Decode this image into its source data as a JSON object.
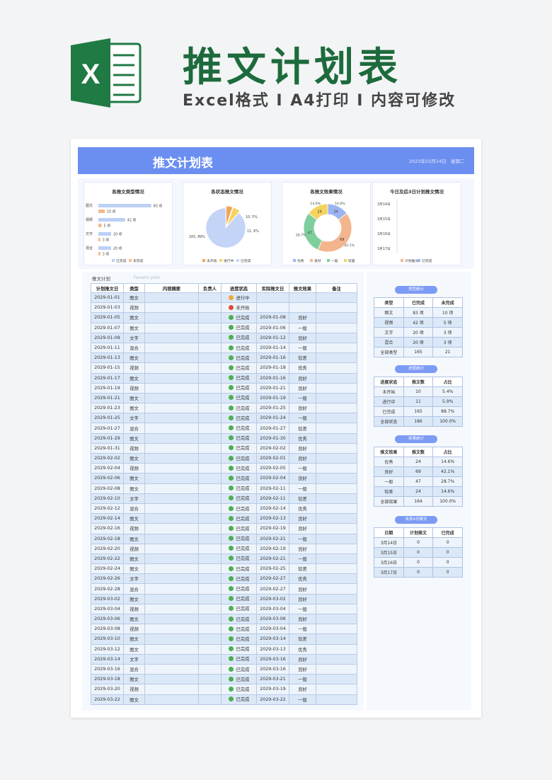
{
  "promo": {
    "logo_letter": "X",
    "title": "推文计划表",
    "subtitle": "Excel格式 I A4打印 I 内容可修改"
  },
  "sheet": {
    "title": "推文计划表",
    "date": "2023年03月14日",
    "weekday": "星期二"
  },
  "charts": {
    "c1": {
      "title": "各推文类型情况",
      "legend": [
        "已完成",
        "未完成"
      ]
    },
    "c2": {
      "title": "各状态推文情况",
      "legend": [
        "未开始",
        "进行中",
        "已完成"
      ]
    },
    "c3": {
      "title": "各推文效果情况",
      "legend": [
        "优秀",
        "良好",
        "一般",
        "较差"
      ]
    },
    "c4": {
      "title": "今日及后3日计划推文情况",
      "legend": [
        "计划推文",
        "已完成"
      ]
    }
  },
  "chart_data": [
    {
      "type": "bar",
      "title": "各推文类型情况",
      "categories": [
        "图文",
        "视频",
        "文字",
        "混合"
      ],
      "series": [
        {
          "name": "已完成",
          "values": [
            83,
            42,
            20,
            20
          ],
          "labels": [
            "83 项",
            "42 项",
            "20 项",
            "20 项"
          ]
        },
        {
          "name": "未完成",
          "values": [
            10,
            5,
            3,
            3
          ],
          "labels": [
            "10 项",
            "5 项",
            "3 项",
            "3 项"
          ]
        }
      ],
      "colors": [
        "#bcd0f6",
        "#f5b98b"
      ],
      "legend": "bottom"
    },
    {
      "type": "pie",
      "title": "各状态推文情况",
      "categories": [
        "未开始",
        "进行中",
        "已完成"
      ],
      "values": [
        10,
        11,
        165
      ],
      "labels": [
        "10, 5%",
        "11, 6%",
        "165, 89%"
      ],
      "colors": [
        "#f0a65a",
        "#f4d35e",
        "#c4d4f7"
      ],
      "legend": "bottom"
    },
    {
      "type": "pie",
      "title": "各推文效果情况",
      "categories": [
        "优秀",
        "良好",
        "一般",
        "较差"
      ],
      "values": [
        24,
        69,
        47,
        24
      ],
      "labels": [
        "14.6%",
        "42.1%",
        "28.7%",
        "14.6%"
      ],
      "counts": [
        "24",
        "69",
        "47",
        "24"
      ],
      "colors": [
        "#9bb5f2",
        "#f3b58e",
        "#7fcf9e",
        "#f4d35e"
      ],
      "legend": "bottom"
    },
    {
      "type": "bar",
      "title": "今日及后3日计划推文情况",
      "categories": [
        "3月14日",
        "3月15日",
        "3月16日",
        "3月17日"
      ],
      "series": [
        {
          "name": "计划推文",
          "values": [
            0,
            0,
            0,
            0
          ]
        },
        {
          "name": "已完成",
          "values": [
            0,
            0,
            0,
            0
          ]
        }
      ],
      "colors": [
        "#f3b58e",
        "#9bb5f2"
      ],
      "legend": "bottom"
    }
  ],
  "plan": {
    "label": "推文计划",
    "label_en": "Tweets plan",
    "headers": [
      "计划推文日",
      "类型",
      "内容摘要",
      "负责人",
      "进度状态",
      "实际推文日",
      "推文效果",
      "备注"
    ],
    "rows": [
      [
        "2029-01-01",
        "图文",
        "",
        "",
        "进行中",
        "",
        "",
        ""
      ],
      [
        "2029-01-03",
        "视频",
        "",
        "",
        "未开始",
        "",
        "",
        ""
      ],
      [
        "2029-01-05",
        "图文",
        "",
        "",
        "已完成",
        "2029-01-08",
        "良好",
        ""
      ],
      [
        "2029-01-07",
        "图文",
        "",
        "",
        "已完成",
        "2029-01-06",
        "一般",
        ""
      ],
      [
        "2029-01-09",
        "文字",
        "",
        "",
        "已完成",
        "2029-01-12",
        "良好",
        ""
      ],
      [
        "2029-01-11",
        "混合",
        "",
        "",
        "已完成",
        "2029-01-14",
        "一般",
        ""
      ],
      [
        "2029-01-13",
        "图文",
        "",
        "",
        "已完成",
        "2029-01-16",
        "较差",
        ""
      ],
      [
        "2029-01-15",
        "视频",
        "",
        "",
        "已完成",
        "2029-01-18",
        "优秀",
        ""
      ],
      [
        "2029-01-17",
        "图文",
        "",
        "",
        "已完成",
        "2029-01-16",
        "良好",
        ""
      ],
      [
        "2029-01-19",
        "视频",
        "",
        "",
        "已完成",
        "2029-01-21",
        "良好",
        ""
      ],
      [
        "2029-01-21",
        "图文",
        "",
        "",
        "已完成",
        "2029-01-19",
        "一般",
        ""
      ],
      [
        "2029-01-23",
        "图文",
        "",
        "",
        "已完成",
        "2029-01-25",
        "良好",
        ""
      ],
      [
        "2029-01-25",
        "文字",
        "",
        "",
        "已完成",
        "2029-01-24",
        "一般",
        ""
      ],
      [
        "2029-01-27",
        "混合",
        "",
        "",
        "已完成",
        "2029-01-27",
        "较差",
        ""
      ],
      [
        "2029-01-29",
        "图文",
        "",
        "",
        "已完成",
        "2029-01-30",
        "优秀",
        ""
      ],
      [
        "2029-01-31",
        "视频",
        "",
        "",
        "已完成",
        "2029-02-02",
        "良好",
        ""
      ],
      [
        "2029-02-02",
        "图文",
        "",
        "",
        "已完成",
        "2029-02-01",
        "良好",
        ""
      ],
      [
        "2029-02-04",
        "视频",
        "",
        "",
        "已完成",
        "2029-02-05",
        "一般",
        ""
      ],
      [
        "2029-02-06",
        "图文",
        "",
        "",
        "已完成",
        "2029-02-04",
        "良好",
        ""
      ],
      [
        "2029-02-08",
        "图文",
        "",
        "",
        "已完成",
        "2029-02-11",
        "一般",
        ""
      ],
      [
        "2029-02-10",
        "文字",
        "",
        "",
        "已完成",
        "2029-02-11",
        "较差",
        ""
      ],
      [
        "2029-02-12",
        "混合",
        "",
        "",
        "已完成",
        "2029-02-14",
        "优秀",
        ""
      ],
      [
        "2029-02-14",
        "图文",
        "",
        "",
        "已完成",
        "2029-02-13",
        "良好",
        ""
      ],
      [
        "2029-02-16",
        "视频",
        "",
        "",
        "已完成",
        "2029-02-19",
        "良好",
        ""
      ],
      [
        "2029-02-18",
        "图文",
        "",
        "",
        "已完成",
        "2029-02-21",
        "一般",
        ""
      ],
      [
        "2029-02-20",
        "视频",
        "",
        "",
        "已完成",
        "2029-02-19",
        "良好",
        ""
      ],
      [
        "2029-02-22",
        "图文",
        "",
        "",
        "已完成",
        "2029-02-21",
        "一般",
        ""
      ],
      [
        "2029-02-24",
        "图文",
        "",
        "",
        "已完成",
        "2029-02-25",
        "较差",
        ""
      ],
      [
        "2029-02-26",
        "文字",
        "",
        "",
        "已完成",
        "2029-02-27",
        "优秀",
        ""
      ],
      [
        "2029-02-28",
        "混合",
        "",
        "",
        "已完成",
        "2029-02-27",
        "良好",
        ""
      ],
      [
        "2029-03-02",
        "图文",
        "",
        "",
        "已完成",
        "2029-03-02",
        "良好",
        ""
      ],
      [
        "2029-03-04",
        "视频",
        "",
        "",
        "已完成",
        "2029-03-04",
        "一般",
        ""
      ],
      [
        "2029-03-06",
        "图文",
        "",
        "",
        "已完成",
        "2029-03-06",
        "良好",
        ""
      ],
      [
        "2029-03-08",
        "视频",
        "",
        "",
        "已完成",
        "2029-03-04",
        "一般",
        ""
      ],
      [
        "2029-03-10",
        "图文",
        "",
        "",
        "已完成",
        "2029-03-14",
        "较差",
        ""
      ],
      [
        "2029-03-12",
        "图文",
        "",
        "",
        "已完成",
        "2029-03-13",
        "优秀",
        ""
      ],
      [
        "2029-03-14",
        "文字",
        "",
        "",
        "已完成",
        "2029-03-16",
        "良好",
        ""
      ],
      [
        "2029-03-16",
        "混合",
        "",
        "",
        "已完成",
        "2029-03-16",
        "良好",
        ""
      ],
      [
        "2029-03-18",
        "图文",
        "",
        "",
        "已完成",
        "2029-03-21",
        "一般",
        ""
      ],
      [
        "2029-03-20",
        "视频",
        "",
        "",
        "已完成",
        "2029-03-19",
        "良好",
        ""
      ],
      [
        "2029-03-22",
        "图文",
        "",
        "",
        "已完成",
        "2029-03-22",
        "一般",
        ""
      ]
    ]
  },
  "stats": {
    "type": {
      "pill": "类型统计",
      "headers": [
        "类型",
        "已完成",
        "未完成"
      ],
      "rows": [
        [
          "图文",
          "83 项",
          "10 项"
        ],
        [
          "视频",
          "42 项",
          "5 项"
        ],
        [
          "文字",
          "20 项",
          "3 项"
        ],
        [
          "混合",
          "20 项",
          "3 项"
        ],
        [
          "全部类型",
          "165",
          "21"
        ]
      ]
    },
    "progress": {
      "pill": "进度统计",
      "headers": [
        "进度状态",
        "推文数",
        "占比"
      ],
      "rows": [
        [
          "未开始",
          "10",
          "5.4%"
        ],
        [
          "进行中",
          "11",
          "5.9%"
        ],
        [
          "已完成",
          "165",
          "88.7%"
        ],
        [
          "全部状态",
          "186",
          "100.0%"
        ]
      ]
    },
    "effect": {
      "pill": "效果统计",
      "headers": [
        "推文效果",
        "推文数",
        "占比"
      ],
      "rows": [
        [
          "优秀",
          "24",
          "14.6%"
        ],
        [
          "良好",
          "69",
          "42.1%"
        ],
        [
          "一般",
          "47",
          "28.7%"
        ],
        [
          "较差",
          "24",
          "14.6%"
        ],
        [
          "全部效果",
          "164",
          "100.0%"
        ]
      ]
    },
    "future": {
      "pill": "未来4日推文",
      "headers": [
        "日期",
        "计划推文",
        "已完成"
      ],
      "rows": [
        [
          "3月14日",
          "0",
          "0"
        ],
        [
          "3月15日",
          "0",
          "0"
        ],
        [
          "3月16日",
          "0",
          "0"
        ],
        [
          "3月17日",
          "0",
          "0"
        ]
      ]
    }
  }
}
